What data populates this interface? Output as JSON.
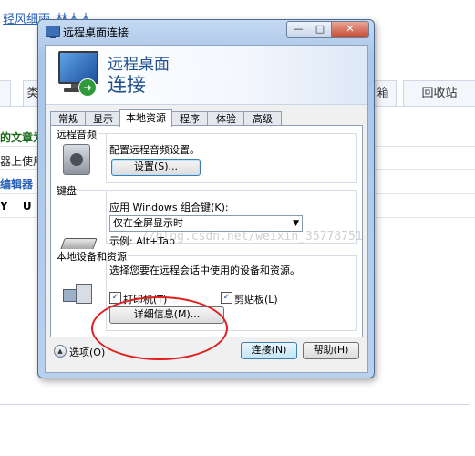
{
  "background": {
    "link_text": "轻风细雨_林木木",
    "tabs": [
      "类",
      "箱",
      "回收站"
    ],
    "lines": [
      "的文章为",
      "器上使用",
      "编辑器"
    ],
    "format_bar": "Y U S",
    "watermark": "//blog.csdn.net/weixin_35778751"
  },
  "window": {
    "title": "远程桌面连接",
    "controls": {
      "minimize": "—",
      "maximize": "□",
      "close": "✕"
    },
    "banner": {
      "line1": "远程桌面",
      "line2": "连接"
    },
    "tabs": [
      "常规",
      "显示",
      "本地资源",
      "程序",
      "体验",
      "高级"
    ],
    "active_tab": "本地资源",
    "audio": {
      "group": "远程音频",
      "description": "配置远程音频设置。",
      "settings_button": "设置(S)..."
    },
    "keyboard": {
      "group": "键盘",
      "apply_label": "应用 Windows 组合键(K):",
      "selected": "仅在全屏显示时",
      "example": "示例: Alt+Tab"
    },
    "devices": {
      "group": "本地设备和资源",
      "description": "选择您要在远程会话中使用的设备和资源。",
      "printer": {
        "label": "打印机(T)",
        "checked": true
      },
      "clipboard": {
        "label": "剪贴板(L)",
        "checked": true
      },
      "details_button": "详细信息(M)..."
    },
    "footer": {
      "options": "选项(O)",
      "connect": "连接(N)",
      "help": "帮助(H)"
    }
  },
  "annotation_color": "#e02020"
}
